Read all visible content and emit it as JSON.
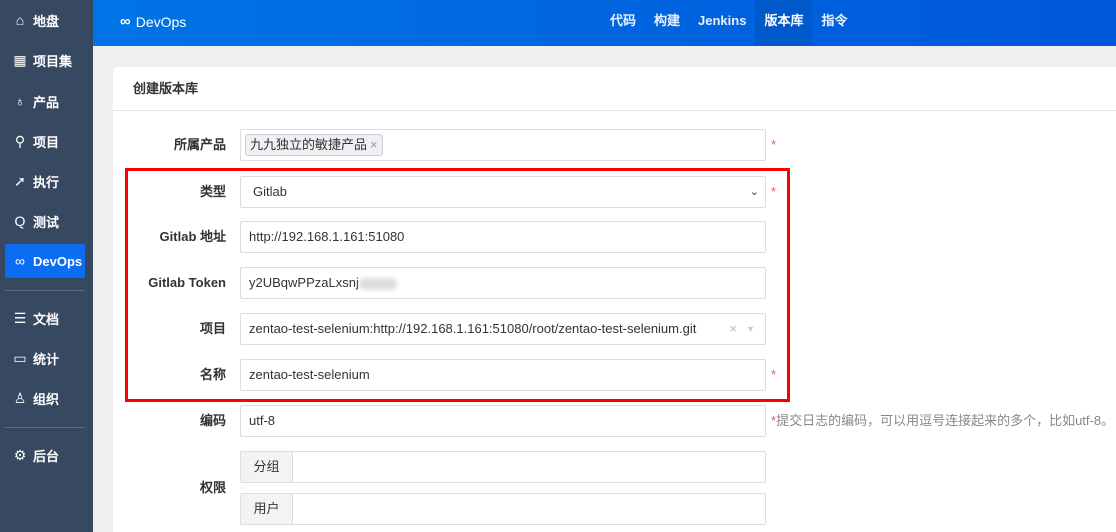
{
  "sidebar": {
    "items": [
      {
        "label": "地盘",
        "icon": "home-icon"
      },
      {
        "label": "项目集",
        "icon": "grid-icon"
      },
      {
        "label": "产品",
        "icon": "lightbulb-icon"
      },
      {
        "label": "项目",
        "icon": "rocket-icon"
      },
      {
        "label": "执行",
        "icon": "run-icon"
      },
      {
        "label": "测试",
        "icon": "search-icon"
      },
      {
        "label": "DevOps",
        "icon": "infinity-icon",
        "active": true
      },
      {
        "label": "文档",
        "icon": "document-icon"
      },
      {
        "label": "统计",
        "icon": "chart-icon"
      },
      {
        "label": "组织",
        "icon": "users-icon"
      },
      {
        "label": "后台",
        "icon": "gear-icon"
      }
    ]
  },
  "header": {
    "brand": "DevOps",
    "brand_icon": "∞",
    "nav": [
      "代码",
      "构建",
      "Jenkins",
      "版本库",
      "指令"
    ],
    "active_nav": "版本库"
  },
  "form": {
    "title": "创建版本库",
    "product": {
      "label": "所属产品",
      "tag": "九九独立的敏捷产品"
    },
    "type": {
      "label": "类型",
      "value": "Gitlab"
    },
    "gitlab_url": {
      "label": "Gitlab 地址",
      "value": "http://192.168.1.161:51080"
    },
    "gitlab_token": {
      "label": "Gitlab Token",
      "value": "y2UBqwPPzaLxsnj"
    },
    "project": {
      "label": "项目",
      "value": "zentao-test-selenium:http://192.168.1.161:51080/root/zentao-test-selenium.git"
    },
    "name": {
      "label": "名称",
      "value": "zentao-test-selenium"
    },
    "encoding": {
      "label": "编码",
      "value": "utf-8",
      "help": "提交日志的编码，可以用逗号连接起来的多个，比如utf-8。"
    },
    "permissions": {
      "label": "权限",
      "group": "分组",
      "user": "用户"
    },
    "required": "*"
  },
  "colors": {
    "accent": "#0c6cf2",
    "sidebar": "#374961",
    "highlight": "#ff0000"
  }
}
